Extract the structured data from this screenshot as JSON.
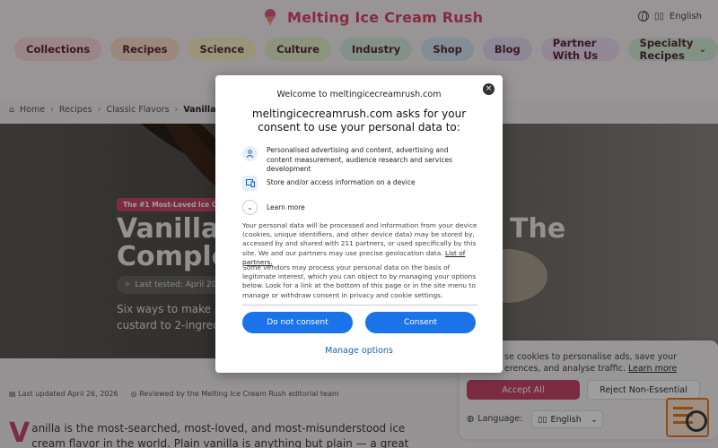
{
  "site": {
    "name": "Melting Ice Cream Rush",
    "language": "English",
    "brand_color": "#d9456b"
  },
  "nav": {
    "items": [
      {
        "label": "Collections",
        "bg": "#f9d7dc"
      },
      {
        "label": "Recipes",
        "bg": "#fbdcc8"
      },
      {
        "label": "Science",
        "bg": "#f8efc6"
      },
      {
        "label": "Culture",
        "bg": "#e2f0c9"
      },
      {
        "label": "Industry",
        "bg": "#d3ecdb"
      },
      {
        "label": "Shop",
        "bg": "#d2e4f3"
      },
      {
        "label": "Blog",
        "bg": "#e2dcf4"
      },
      {
        "label": "Partner With Us",
        "bg": "#eddcf0"
      },
      {
        "label": "Specialty Recipes",
        "bg": "#d5ecd7"
      }
    ]
  },
  "breadcrumb": {
    "items": [
      "Home",
      "Recipes",
      "Classic Flavors",
      "Vanilla Ice"
    ]
  },
  "hero": {
    "badge": "The #1 Most-Loved Ice C",
    "title_line1": "Vanilla",
    "title_line1_right": "The",
    "title_line2": "Comple",
    "tested": "Last tested: April 202",
    "subtitle_line1": "Six ways to make p",
    "subtitle_line2": "custard to 2-ingredi"
  },
  "byline": {
    "updated": "Last updated April 26, 2026",
    "reviewed": "Reviewed by the Melting Ice Cream Rush editorial team"
  },
  "article": {
    "dropcap": "V",
    "text": "anilla is the most-searched, most-loved, and most-misunderstood ice cream flavor in the world. Plain vanilla is anything but plain — a great vanilla ice"
  },
  "cookie_banner": {
    "text_part": "se cookies to personalise ads, save your",
    "text_part2": "erences, and analyse traffic.",
    "learn_more": "Learn more",
    "accept": "Accept All",
    "reject": "Reject Non-Essential",
    "language_label": "Language:",
    "language_value": "English"
  },
  "consent_modal": {
    "welcome": "Welcome to meltingicecreamrush.com",
    "close": "×",
    "title": "meltingicecreamrush.com asks for your consent to use your personal data to:",
    "purposes": [
      {
        "icon": "person-icon",
        "glyph": "👤",
        "text": "Personalised advertising and content, advertising and content measurement, audience research and services development"
      },
      {
        "icon": "device-icon",
        "glyph": "▭",
        "text": "Store and/or access information on a device"
      }
    ],
    "learn_more": "Learn more",
    "para1": "Your personal data will be processed and information from your device (cookies, unique identifiers, and other device data) may be stored by, accessed by and shared with 211 partners, or used specifically by this site. We and our partners may use precise geolocation data.",
    "partners_link": "List of partners.",
    "para2": "Some vendors may process your personal data on the basis of legitimate interest, which you can object to by managing your options below. Look for a link at the bottom of this page or in the site menu to manage or withdraw consent in privacy and cookie settings.",
    "do_not_consent": "Do not consent",
    "consent": "Consent",
    "manage_options": "Manage options",
    "button_color": "#1a73e8"
  }
}
